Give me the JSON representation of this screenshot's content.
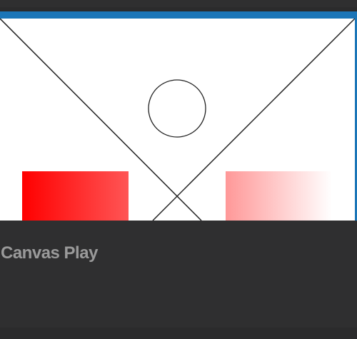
{
  "card": {
    "title": "Canvas Play"
  },
  "colors": {
    "frame_border": "#1b76b8",
    "canvas_background": "#ffffff",
    "card_background": "#2f2f30",
    "title_text": "#9a9a9a",
    "line_stroke": "#222222",
    "gradient_red_start": "#ff0000",
    "gradient_red_end": "#ff5555",
    "gradient_pink_start": "#ff9898",
    "gradient_pink_end": "#ffffff"
  }
}
